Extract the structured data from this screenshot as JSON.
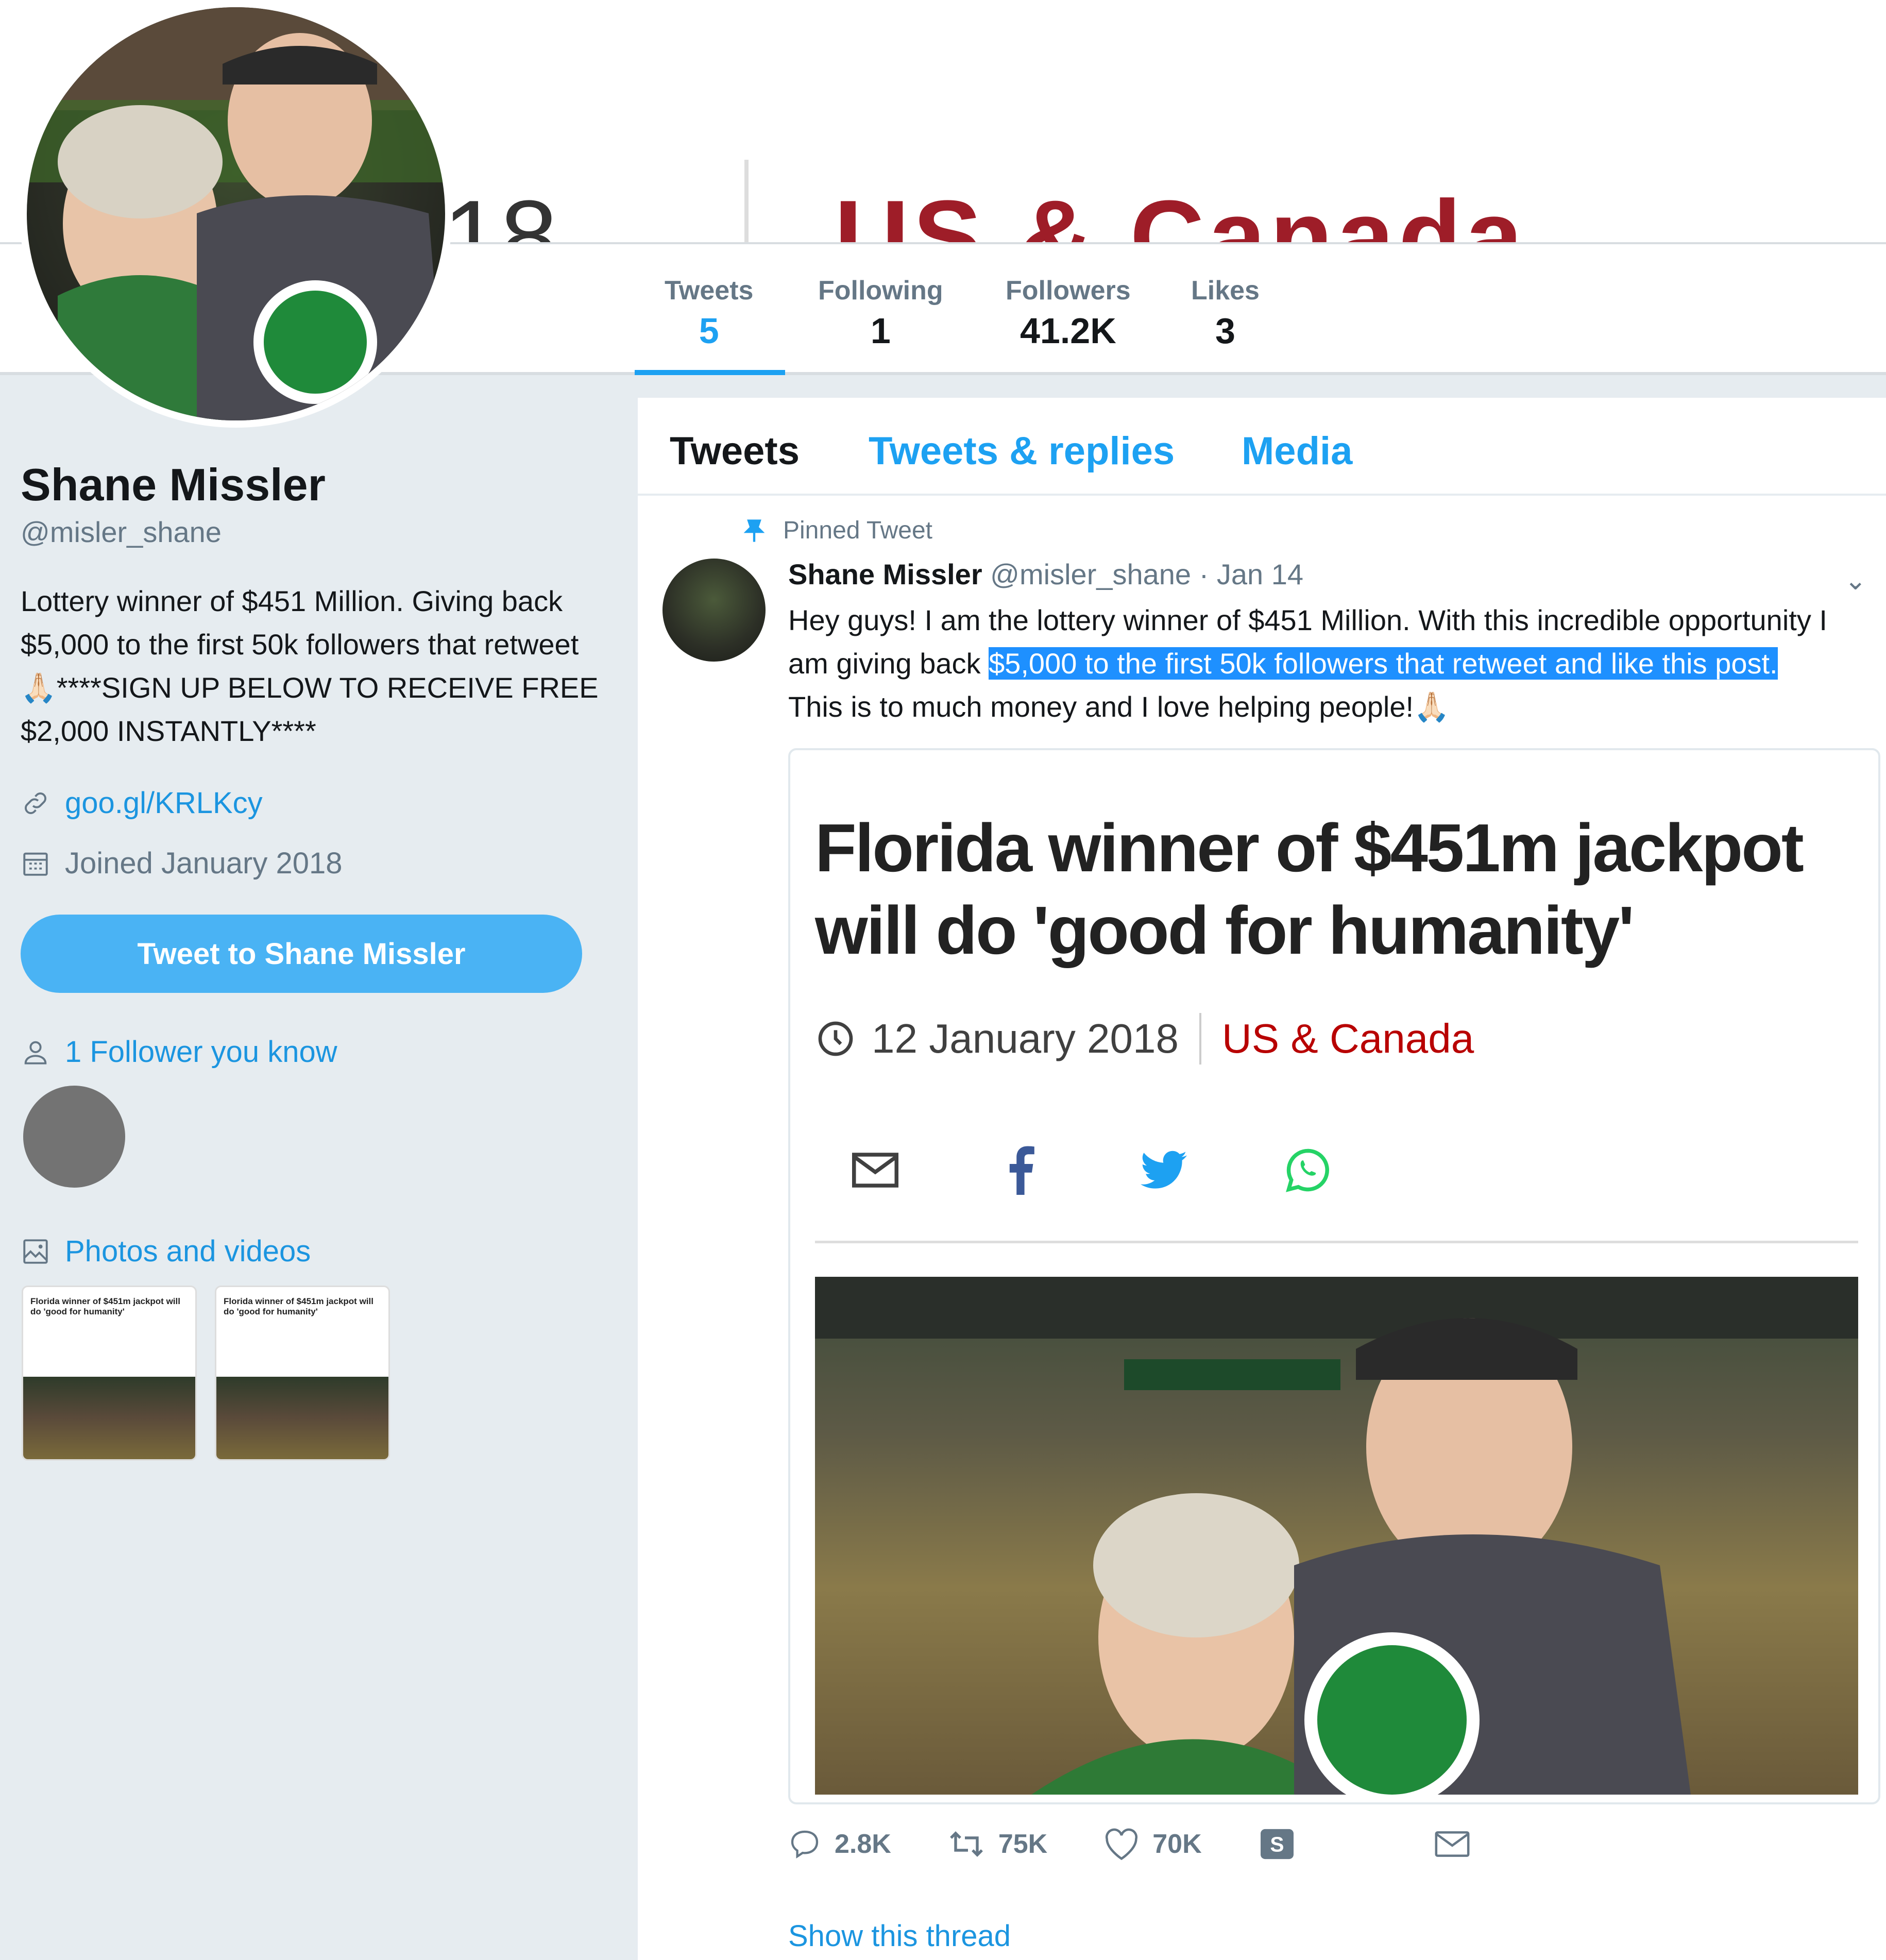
{
  "banner": {
    "year_partial": "18",
    "region_partial": "US & Canada"
  },
  "nav": {
    "items": [
      {
        "label": "Tweets",
        "value": "5"
      },
      {
        "label": "Following",
        "value": "1"
      },
      {
        "label": "Followers",
        "value": "41.2K"
      },
      {
        "label": "Likes",
        "value": "3"
      }
    ]
  },
  "profile": {
    "name": "Shane Missler",
    "handle": "@misler_shane",
    "bio_part1": "Lottery winner of $451 Million. Giving back $5,000 to the first 50k followers that retweet",
    "bio_part2": "****SIGN UP BELOW TO RECEIVE FREE $2,000 INSTANTLY****",
    "link": "goo.gl/KRLKcy",
    "joined": "Joined January 2018",
    "tweet_button": "Tweet to Shane Missler",
    "followers_you_know": "1 Follower you know",
    "photos_and_videos": "Photos and videos",
    "thumb_headline": "Florida winner of $451m jackpot will do 'good for humanity'"
  },
  "tabs": [
    "Tweets",
    "Tweets & replies",
    "Media"
  ],
  "tweet": {
    "pinned_label": "Pinned Tweet",
    "author_name": "Shane Missler",
    "author_handle": "@misler_shane",
    "date": "· Jan 14",
    "text_part1": "Hey guys! I am the lottery winner of $451 Million. With this incredible opportunity I am giving back ",
    "text_highlight": "$5,000 to the first 50k followers that retweet and like this post.",
    "text_part2": "This is to much money and I love helping people!",
    "card": {
      "headline": "Florida winner of $451m jackpot will do 'good for humanity'",
      "date": "12 January 2018",
      "region": "US & Canada"
    },
    "replies": "2.8K",
    "retweets": "75K",
    "likes": "70K",
    "show_thread": "Show this thread"
  },
  "colors": {
    "accent": "#1da1f2",
    "button": "#4ab3f4",
    "region_red": "#b80000",
    "highlight": "#1e90ff"
  }
}
